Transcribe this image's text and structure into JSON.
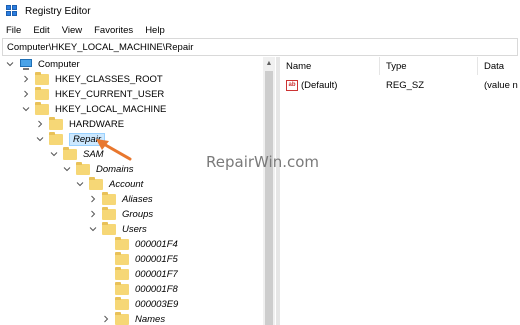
{
  "window": {
    "title": "Registry Editor"
  },
  "menu": [
    "File",
    "Edit",
    "View",
    "Favorites",
    "Help"
  ],
  "address": "Computer\\HKEY_LOCAL_MACHINE\\Repair",
  "tree": {
    "computer": "Computer",
    "hkcr": "HKEY_CLASSES_ROOT",
    "hkcu": "HKEY_CURRENT_USER",
    "hklm": "HKEY_LOCAL_MACHINE",
    "hardware": "HARDWARE",
    "repair": "Repair",
    "sam": "SAM",
    "domains": "Domains",
    "account": "Account",
    "aliases": "Aliases",
    "groups": "Groups",
    "users": "Users",
    "user_keys": [
      "000001F4",
      "000001F5",
      "000001F7",
      "000001F8",
      "000003E9"
    ],
    "names": "Names"
  },
  "list": {
    "columns": [
      "Name",
      "Type",
      "Data"
    ],
    "rows": [
      {
        "name": "(Default)",
        "type": "REG_SZ",
        "data": "(value n"
      }
    ]
  },
  "watermark": "RepairWin.com",
  "colors": {
    "selection": "#cce8ff",
    "annotation_arrow": "#e8772e",
    "folder": "#f6d776"
  },
  "icons": [
    "registry-editor-icon",
    "computer-icon",
    "folder-icon",
    "string-value-icon"
  ]
}
